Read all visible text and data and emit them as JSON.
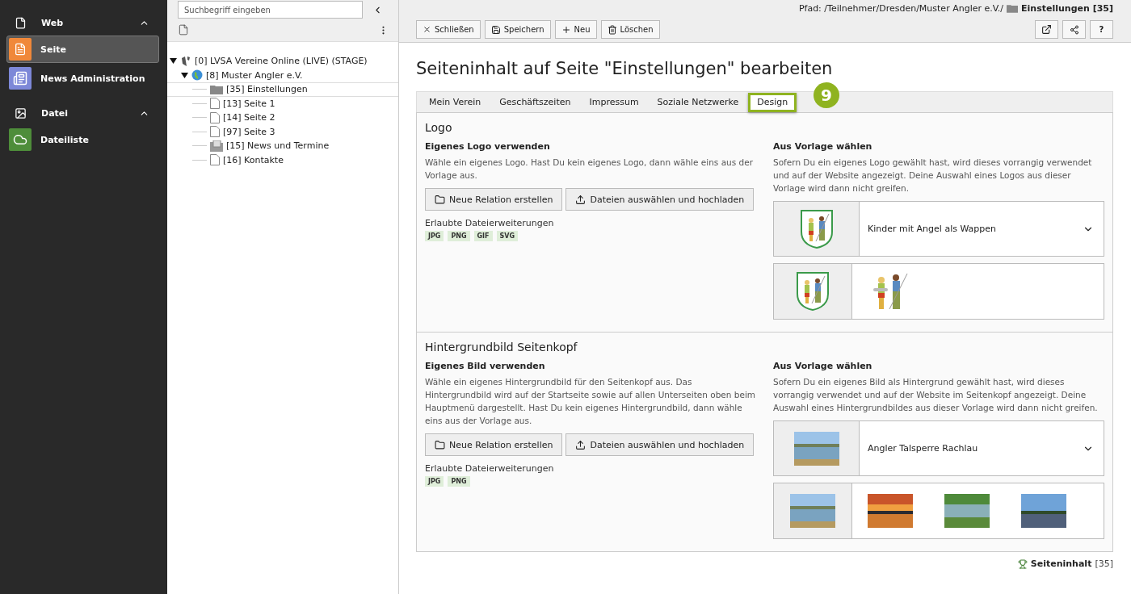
{
  "modules": [
    {
      "label": "Web",
      "kind": "page",
      "expanded": true,
      "items": [
        {
          "label": "Seite",
          "kind": "page",
          "color": "#f0883a",
          "selected": true
        },
        {
          "label": "News Administration",
          "kind": "news",
          "color": "#7d88d8",
          "selected": false
        }
      ]
    },
    {
      "label": "Datei",
      "kind": "image",
      "expanded": true,
      "items": [
        {
          "label": "Dateiliste",
          "kind": "cloud",
          "color": "#4e8d3a",
          "selected": false
        }
      ]
    }
  ],
  "tree": {
    "search": {
      "placeholder": "Suchbegriff eingeben"
    },
    "nodes": [
      {
        "label": "[0] LVSA Vereine Online (LIVE) (STAGE)",
        "kind": "root",
        "expanded": true,
        "selected": false,
        "children": [
          {
            "label": "[8] Muster Angler e.V.",
            "kind": "globe",
            "expanded": true,
            "selected": false,
            "children": [
              {
                "label": "[35] Einstellungen",
                "kind": "folder",
                "selected": true
              },
              {
                "label": "[13] Seite 1",
                "kind": "page",
                "selected": false
              },
              {
                "label": "[14] Seite 2",
                "kind": "page",
                "selected": false
              },
              {
                "label": "[97] Seite 3",
                "kind": "page",
                "selected": false
              },
              {
                "label": "[15] News und Termine",
                "kind": "news",
                "selected": false
              },
              {
                "label": "[16] Kontakte",
                "kind": "page",
                "selected": false
              }
            ]
          }
        ]
      }
    ]
  },
  "path": {
    "prefix": "Pfad: /Teilnehmer/Dresden/Muster Angler e.V./",
    "current": "Einstellungen [35]"
  },
  "toolbar": [
    {
      "kind": "close",
      "label": "Schließen"
    },
    {
      "kind": "save",
      "label": "Speichern"
    },
    {
      "kind": "new",
      "label": "Neu"
    },
    {
      "kind": "delete",
      "label": "Löschen"
    }
  ],
  "toolbar_right": [
    {
      "kind": "open"
    },
    {
      "kind": "share"
    },
    {
      "kind": "help",
      "label": "?"
    }
  ],
  "title": "Seiteninhalt auf Seite \"Einstellungen\" bearbeiten",
  "tabs": [
    {
      "label": "Mein Verein",
      "selected": false
    },
    {
      "label": "Geschäftszeiten",
      "selected": false
    },
    {
      "label": "Impressum",
      "selected": false
    },
    {
      "label": "Soziale Netzwerke",
      "selected": false
    },
    {
      "label": "Design",
      "selected": true
    }
  ],
  "callout": "9",
  "sections": [
    {
      "title": "Logo",
      "left": {
        "heading": "Eigenes Logo verwenden",
        "text": "Wähle ein eigenes Logo. Hast Du kein eigenes Logo, dann wähle eins aus der Vorlage aus.",
        "buttons": [
          {
            "kind": "relation",
            "label": "Neue Relation erstellen"
          },
          {
            "kind": "upload",
            "label": "Dateien auswählen und hochladen"
          }
        ],
        "ext_label": "Erlaubte Dateierweiterungen",
        "extensions": [
          "JPG",
          "PNG",
          "GIF",
          "SVG"
        ]
      },
      "right": {
        "heading": "Aus Vorlage wählen",
        "text": "Sofern Du ein eigenes Logo gewählt hast, wird dieses vorrangig verwendet und auf der Website angezeigt. Deine Auswahl eines Logos aus dieser Vorlage wird dann nicht greifen.",
        "select": {
          "kind": "shield",
          "value": "Kinder mit Angel als Wappen"
        },
        "options": [
          {
            "kind": "shield",
            "selected": true
          },
          {
            "kind": "children",
            "selected": false
          }
        ]
      }
    },
    {
      "title": "Hintergrundbild Seitenkopf",
      "left": {
        "heading": "Eigenes Bild verwenden",
        "text": "Wähle ein eigenes Hintergrundbild für den Seitenkopf aus. Das Hintergrundbild wird auf der Startseite sowie auf allen Unterseiten oben beim Hauptmenü dargestellt. Hast Du kein eigenes Hintergrundbild, dann wähle eins aus der Vorlage aus.",
        "buttons": [
          {
            "kind": "relation",
            "label": "Neue Relation erstellen"
          },
          {
            "kind": "upload",
            "label": "Dateien auswählen und hochladen"
          }
        ],
        "ext_label": "Erlaubte Dateierweiterungen",
        "extensions": [
          "JPG",
          "PNG"
        ]
      },
      "right": {
        "heading": "Aus Vorlage wählen",
        "text": "Sofern Du ein eigenes Bild als Hintergrund gewählt hast, wird dieses vorrangig verwendet und auf der Website im Seitenkopf angezeigt. Deine Auswahl eines Hintergrundbildes aus dieser Vorlage wird dann nicht greifen.",
        "select": {
          "kind": "lake",
          "value": "Angler Talsperre Rachlau"
        },
        "options": [
          {
            "kind": "lake",
            "selected": true
          },
          {
            "kind": "sunset",
            "selected": false
          },
          {
            "kind": "meadow",
            "selected": false
          },
          {
            "kind": "shore",
            "selected": false
          }
        ]
      }
    }
  ],
  "footer": {
    "label": "Seiteninhalt",
    "id": "[35]"
  }
}
